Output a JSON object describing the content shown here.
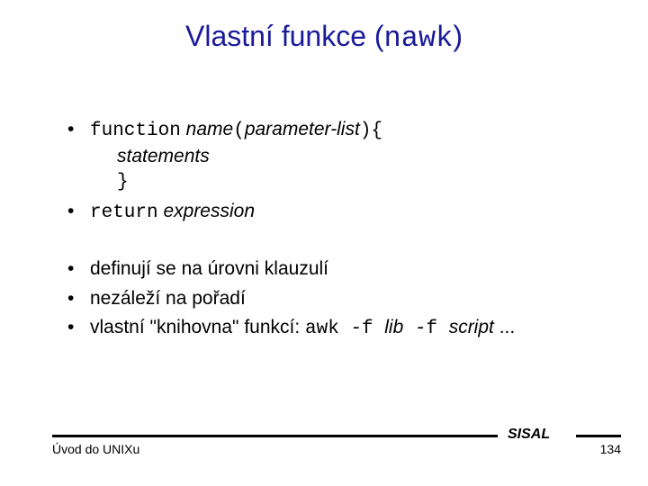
{
  "title": {
    "pre": "Vlastní funkce (",
    "mono": "nawk",
    "post": ")"
  },
  "b1": {
    "kw_function": "function",
    "name": " name",
    "lparen": "(",
    "params": "parameter-list",
    "rparen_brace": "){"
  },
  "stmt": "statements",
  "close_brace": "}",
  "b2": {
    "kw_return": "return",
    "expr": " expression"
  },
  "b3": "definují se na úrovni klauzulí",
  "b4": "nezáleží na pořadí",
  "b5": {
    "pre": "vlastní \"knihovna\" funkcí: ",
    "code1": "awk -f ",
    "arg1": "lib",
    "code2": " -f ",
    "arg2": "script",
    "post": " ..."
  },
  "footer": {
    "left": "Úvod do UNIXu",
    "center": "SISAL",
    "right": "134"
  }
}
